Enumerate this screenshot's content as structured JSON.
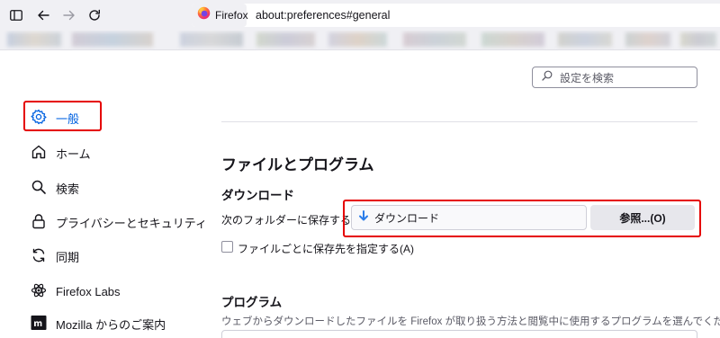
{
  "browser": {
    "identity_label": "Firefox",
    "url": "about:preferences#general"
  },
  "search": {
    "placeholder": "設定を検索"
  },
  "sidebar": {
    "items": [
      {
        "label": "一般",
        "icon": "gear-icon",
        "selected": true
      },
      {
        "label": "ホーム",
        "icon": "home-icon"
      },
      {
        "label": "検索",
        "icon": "search-icon"
      },
      {
        "label": "プライバシーとセキュリティ",
        "icon": "lock-icon"
      },
      {
        "label": "同期",
        "icon": "sync-icon"
      },
      {
        "label": "Firefox Labs",
        "icon": "labs-icon"
      },
      {
        "label": "Mozilla からのご案内",
        "icon": "mozilla-icon"
      }
    ]
  },
  "main": {
    "section_title": "ファイルとプログラム",
    "downloads": {
      "heading": "ダウンロード",
      "save_to_label": "次のフォルダーに保存する(V)",
      "folder_value": "ダウンロード",
      "browse_button": "参照...(O)",
      "ask_checkbox_label": "ファイルごとに保存先を指定する(A)"
    },
    "applications": {
      "heading": "プログラム",
      "description": "ウェブからダウンロードしたファイルを Firefox が取り扱う方法と閲覧中に使用するプログラムを選んでください。"
    }
  },
  "colors": {
    "accent": "#0061e0",
    "highlight_red": "#e50000"
  }
}
